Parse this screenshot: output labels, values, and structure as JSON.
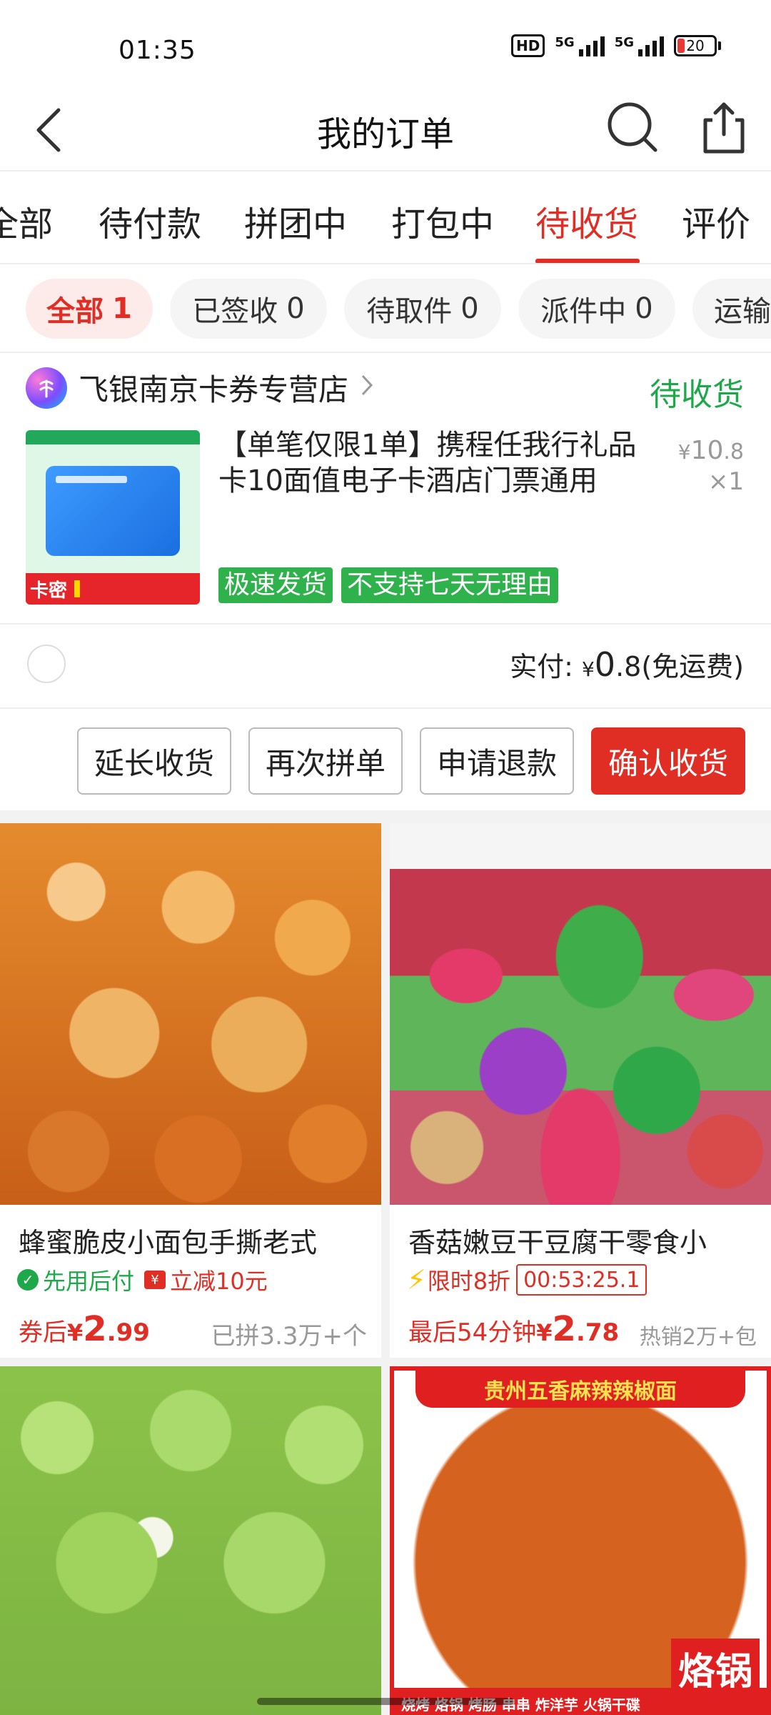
{
  "status_bar": {
    "time": "01:35",
    "hd": "HD",
    "network_1": "5G",
    "network_2": "5G",
    "battery": "20",
    "battery_color": "#e53935"
  },
  "header": {
    "title": "我的订单",
    "back_icon": "back-arrow-icon",
    "search_icon": "search-icon",
    "share_icon": "share-icon"
  },
  "tabs": [
    {
      "label": "全部"
    },
    {
      "label": "待付款"
    },
    {
      "label": "拼团中"
    },
    {
      "label": "打包中"
    },
    {
      "label": "待收货",
      "active": true
    },
    {
      "label": "评价"
    }
  ],
  "chips": [
    {
      "label": "全部",
      "count": "1",
      "active": true
    },
    {
      "label": "已签收",
      "count": "0"
    },
    {
      "label": "待取件",
      "count": "0"
    },
    {
      "label": "派件中",
      "count": "0"
    },
    {
      "label": "运输"
    }
  ],
  "order": {
    "shop_name": "飞银南京卡券专营店",
    "status": "待收货",
    "product_title": "【单笔仅限1单】携程任我行礼品卡10面值电子卡酒店门票通用",
    "price_symbol": "¥",
    "price_int": "10",
    "price_dec": ".8",
    "quantity": "×1",
    "thumb_badge": "卡密",
    "tags": [
      "极速发货",
      "不支持七天无理由"
    ],
    "paid_label": "实付:",
    "paid_symbol": "¥",
    "paid_int": "0",
    "paid_dec": ".8",
    "paid_note": "(免运费)",
    "buttons": [
      "延长收货",
      "再次拼单",
      "申请退款",
      "确认收货"
    ]
  },
  "recommendations": [
    {
      "title": "蜂蜜脆皮小面包手撕老式",
      "badge1": "先用后付",
      "badge2": "立减10元",
      "price_prefix": "券后",
      "price_symbol": "¥",
      "price_int": "2",
      "price_dec": ".99",
      "sold": "已拼3.3万+个"
    },
    {
      "title": "香菇嫩豆干豆腐干零食小",
      "flash_label": "限时8折",
      "countdown": "00:53:25.1",
      "price_prefix": "最后54分钟",
      "price_symbol": "¥",
      "price_int": "2",
      "price_dec": ".78",
      "sold": "热销2万+包"
    },
    {
      "title": ""
    },
    {
      "banner": "贵州五香麻辣辣椒面",
      "strip": "烧烤 烙锅 烤肠 串串 炸洋芋 火锅干碟",
      "big": "烙锅"
    }
  ],
  "colors": {
    "accent": "#e02e24",
    "green": "#1ea84a",
    "tag_green": "#2fb24b"
  }
}
